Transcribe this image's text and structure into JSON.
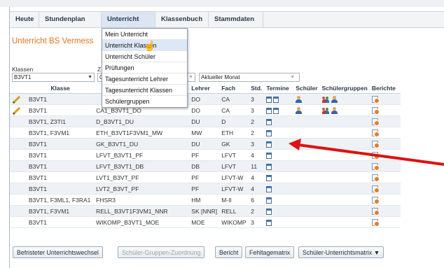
{
  "nav": {
    "tabs": [
      "Heute",
      "Stundenplan",
      "Unterricht",
      "Klassenbuch",
      "Stammdaten"
    ]
  },
  "menu": {
    "items": [
      "Mein Unterricht",
      "Unterricht Klassen",
      "Unterricht Schüler",
      "Prüfungen",
      "Tagesunterricht Lehrer",
      "Tagesunterricht Klassen",
      "Schülergruppen"
    ]
  },
  "page": {
    "title": "Unterricht BS Vermess",
    "klassen_label": "Klassen",
    "klassen_value": "B3VT1",
    "z_label": "Z",
    "z_value": "C",
    "period_value": "Aktueller Monat"
  },
  "table": {
    "headers": [
      "Klasse",
      "Lehrer",
      "Fach",
      "Std.",
      "Termine",
      "Schüler",
      "Schülergruppen",
      "Berichte"
    ],
    "rows": [
      {
        "klasse": "B3VT1",
        "unterricht": "",
        "lehrer": "DO",
        "fach": "CA",
        "std": "3",
        "termine": 2,
        "schueler": true,
        "gruppen": true,
        "edit": true
      },
      {
        "klasse": "B3VT1",
        "unterricht": "CA1_B3VT1_DO",
        "lehrer": "DO",
        "fach": "CA",
        "std": "3",
        "termine": 2,
        "schueler": true,
        "gruppen": true,
        "edit": true
      },
      {
        "klasse": "B3VT1, Z3TI1",
        "unterricht": "D_B3VT1_DU",
        "lehrer": "DU",
        "fach": "D",
        "std": "2",
        "termine": 1,
        "schueler": false,
        "gruppen": false,
        "edit": false
      },
      {
        "klasse": "B3VT1, F3VM1",
        "unterricht": "ETH_B3VT1F3VM1_MW",
        "lehrer": "MW",
        "fach": "ETH",
        "std": "2",
        "termine": 1,
        "schueler": false,
        "gruppen": false,
        "edit": false
      },
      {
        "klasse": "B3VT1",
        "unterricht": "GK_B3VT1_DU",
        "lehrer": "DU",
        "fach": "GK",
        "std": "3",
        "termine": 1,
        "schueler": false,
        "gruppen": false,
        "edit": false
      },
      {
        "klasse": "B3VT1",
        "unterricht": "LFVT_B3VT1_PF",
        "lehrer": "PF",
        "fach": "LFVT",
        "std": "4",
        "termine": 1,
        "schueler": false,
        "gruppen": false,
        "edit": false
      },
      {
        "klasse": "B3VT1",
        "unterricht": "LFVT_B3VT1_DB",
        "lehrer": "DB",
        "fach": "LFVT",
        "std": "11",
        "termine": 1,
        "schueler": false,
        "gruppen": false,
        "edit": false
      },
      {
        "klasse": "B3VT1",
        "unterricht": "LVT1_B3VT_PF",
        "lehrer": "PF",
        "fach": "LFVT-W",
        "std": "4",
        "termine": 1,
        "schueler": false,
        "gruppen": false,
        "edit": false
      },
      {
        "klasse": "B3VT1",
        "unterricht": "LVT2_B3VT_PF",
        "lehrer": "PF",
        "fach": "LFVT-W",
        "std": "4",
        "termine": 1,
        "schueler": false,
        "gruppen": false,
        "edit": false
      },
      {
        "klasse": "B3VT1, F3ML1, F3RA1",
        "unterricht": "FHSR3",
        "lehrer": "HM",
        "fach": "M-II",
        "std": "6",
        "termine": 1,
        "schueler": false,
        "gruppen": false,
        "edit": false
      },
      {
        "klasse": "B3VT1, F3VM1",
        "unterricht": "RELL_B3VT1F3VM1_NNR",
        "lehrer": "SK [NNR]",
        "fach": "RELL",
        "std": "2",
        "termine": 1,
        "schueler": false,
        "gruppen": false,
        "edit": false
      },
      {
        "klasse": "B3VT1",
        "unterricht": "WIKOMP_B3VT1_MOE",
        "lehrer": "MOE",
        "fach": "WIKOMP",
        "std": "3",
        "termine": 1,
        "schueler": false,
        "gruppen": false,
        "edit": false
      }
    ]
  },
  "buttons": {
    "b1": "Befristeter Unterrichtswechsel",
    "b2": "Schüler-Gruppen-Zuordnung",
    "b3": "Bericht",
    "b4": "Fehltagematrix",
    "b5": "Schüler-Unterrichtsmatrix ▼"
  },
  "colors": {
    "title": "#e0741b",
    "arrow": "#e01010",
    "menu_highlight": "#dce8f5"
  }
}
